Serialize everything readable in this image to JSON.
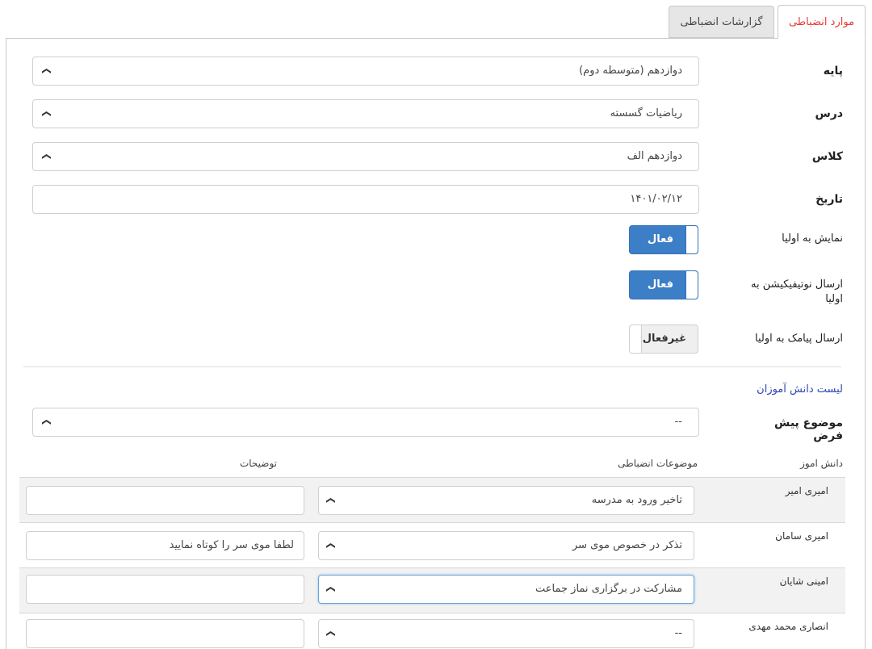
{
  "tabs": [
    {
      "label": "موارد انضباطی",
      "active": true
    },
    {
      "label": "گزارشات انضباطی",
      "active": false
    }
  ],
  "form": {
    "grade": {
      "label": "پایه",
      "value": "دوازدهم (متوسطه دوم)"
    },
    "course": {
      "label": "درس",
      "value": "ریاضیات گسسته"
    },
    "class": {
      "label": "کلاس",
      "value": "دوازدهم الف"
    },
    "date": {
      "label": "تاریخ",
      "value": "۱۴۰۱/۰۲/۱۲"
    },
    "show_to_parents": {
      "label": "نمایش به اولیا",
      "state": "فعال",
      "on": true
    },
    "notify_parents": {
      "label": "ارسال نوتیفیکیشن به اولیا",
      "state": "فعال",
      "on": true
    },
    "sms_parents": {
      "label": "ارسال پیامک به اولیا",
      "state": "غیرفعال",
      "on": false
    }
  },
  "students_section": {
    "title": "لیست دانش آموزان",
    "default_topic": {
      "label": "موضوع پیش فرض",
      "value": "--"
    },
    "columns": {
      "student": "دانش اموز",
      "topics": "موضوعات انضباطی",
      "notes": "توضیحات"
    },
    "rows": [
      {
        "name": "امیری امیر",
        "topic": "تاخیر ورود به مدرسه",
        "note": ""
      },
      {
        "name": "امیری سامان",
        "topic": "تذکر در خصوص موی سر",
        "note": "لطفا موی سر را کوتاه نمایید"
      },
      {
        "name": "امینی شایان",
        "topic": "مشارکت در برگزاری نماز جماعت",
        "note": ""
      },
      {
        "name": "انصاری محمد مهدی",
        "topic": "--",
        "note": ""
      }
    ]
  },
  "colors": {
    "accent": "#3d7fc7",
    "active_tab": "#e53935",
    "link": "#2b46b5"
  }
}
